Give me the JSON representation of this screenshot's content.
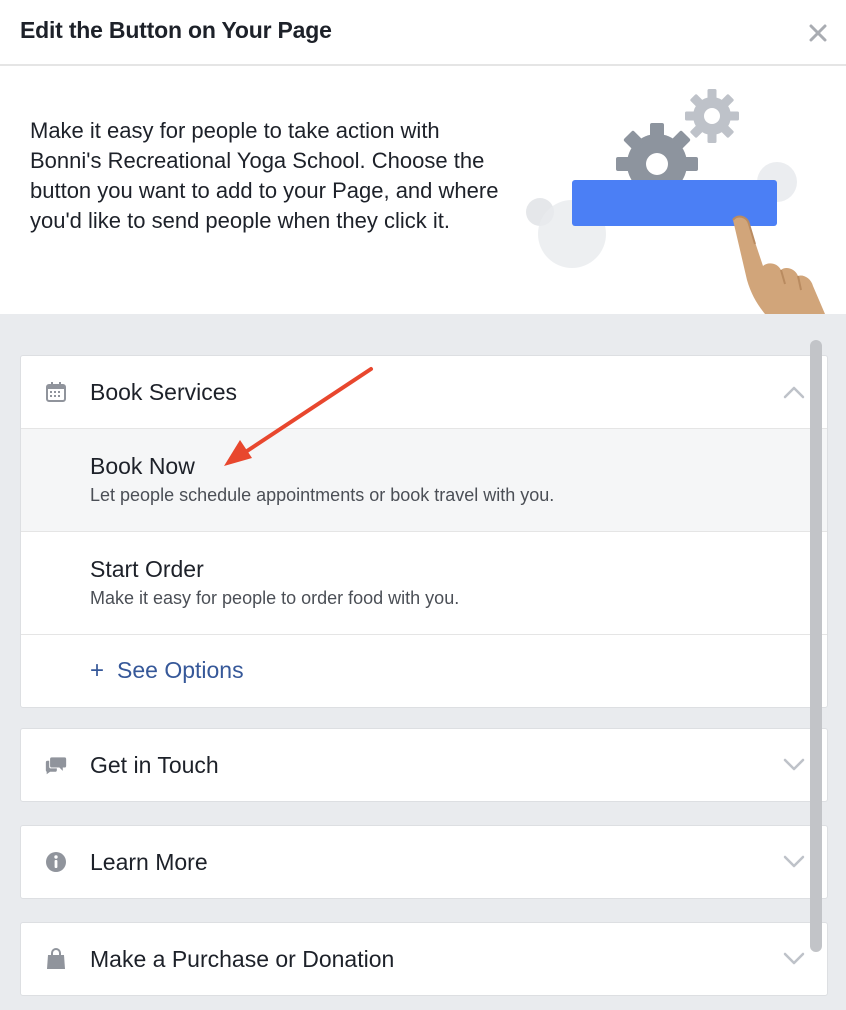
{
  "header": {
    "title": "Edit the Button on Your Page",
    "close_icon": "close-icon"
  },
  "intro": {
    "text": "Make it easy for people to take action with Bonni's Recreational Yoga School. Choose the button you want to add to your Page, and where you'd like to send people when they click it."
  },
  "categories": [
    {
      "label": "Book Services",
      "icon": "calendar-icon",
      "expanded": true,
      "options": [
        {
          "title": "Book Now",
          "description": "Let people schedule appointments or book travel with you.",
          "highlighted": true
        },
        {
          "title": "Start Order",
          "description": "Make it easy for people to order food with you.",
          "highlighted": false
        }
      ],
      "see_options": {
        "plus": "+",
        "label": "See Options"
      }
    },
    {
      "label": "Get in Touch",
      "icon": "chat-bubbles-icon",
      "expanded": false
    },
    {
      "label": "Learn More",
      "icon": "info-icon",
      "expanded": false
    },
    {
      "label": "Make a Purchase or Donation",
      "icon": "shopping-bag-icon",
      "expanded": false
    }
  ],
  "colors": {
    "link": "#365899",
    "illustration_button": "#4b7ff5",
    "annotation_arrow": "#e8472e",
    "icon_gray": "#90949c"
  }
}
